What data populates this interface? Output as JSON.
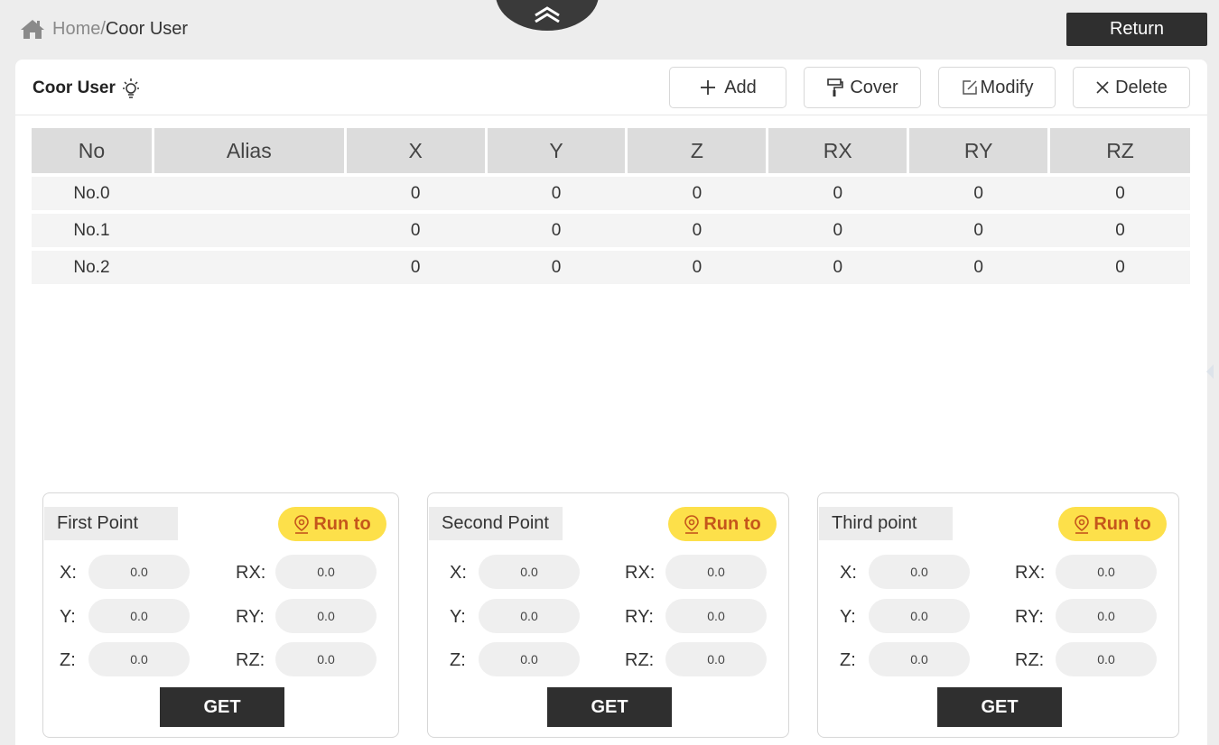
{
  "breadcrumb": {
    "home": "Home",
    "separator": "/",
    "current": "Coor User"
  },
  "return_label": "Return",
  "panel": {
    "title": "Coor User"
  },
  "toolbar": {
    "add": "Add",
    "cover": "Cover",
    "modify": "Modify",
    "delete": "Delete"
  },
  "table": {
    "headers": [
      "No",
      "Alias",
      "X",
      "Y",
      "Z",
      "RX",
      "RY",
      "RZ"
    ],
    "rows": [
      [
        "No.0",
        "",
        "0",
        "0",
        "0",
        "0",
        "0",
        "0"
      ],
      [
        "No.1",
        "",
        "0",
        "0",
        "0",
        "0",
        "0",
        "0"
      ],
      [
        "No.2",
        "",
        "0",
        "0",
        "0",
        "0",
        "0",
        "0"
      ]
    ]
  },
  "points": [
    {
      "title": "First Point",
      "run_label": "Run to",
      "x_label": "X:",
      "y_label": "Y:",
      "z_label": "Z:",
      "rx_label": "RX:",
      "ry_label": "RY:",
      "rz_label": "RZ:",
      "x": "0.0",
      "y": "0.0",
      "z": "0.0",
      "rx": "0.0",
      "ry": "0.0",
      "rz": "0.0",
      "get_label": "GET"
    },
    {
      "title": "Second Point",
      "run_label": "Run to",
      "x_label": "X:",
      "y_label": "Y:",
      "z_label": "Z:",
      "rx_label": "RX:",
      "ry_label": "RY:",
      "rz_label": "RZ:",
      "x": "0.0",
      "y": "0.0",
      "z": "0.0",
      "rx": "0.0",
      "ry": "0.0",
      "rz": "0.0",
      "get_label": "GET"
    },
    {
      "title": "Third point",
      "run_label": "Run to",
      "x_label": "X:",
      "y_label": "Y:",
      "z_label": "Z:",
      "rx_label": "RX:",
      "ry_label": "RY:",
      "rz_label": "RZ:",
      "x": "0.0",
      "y": "0.0",
      "z": "0.0",
      "rx": "0.0",
      "ry": "0.0",
      "rz": "0.0",
      "get_label": "GET"
    }
  ],
  "icons": {
    "home": "home-icon",
    "collapse": "double-chevron-up-icon",
    "bulb": "lightbulb-icon",
    "add": "plus-icon",
    "cover": "paint-roller-icon",
    "modify": "edit-icon",
    "delete": "close-icon",
    "run": "location-pin-icon"
  },
  "colors": {
    "accent_yellow": "#fde04a",
    "run_text": "#c5561b",
    "dark_button": "#2f2f2f"
  }
}
